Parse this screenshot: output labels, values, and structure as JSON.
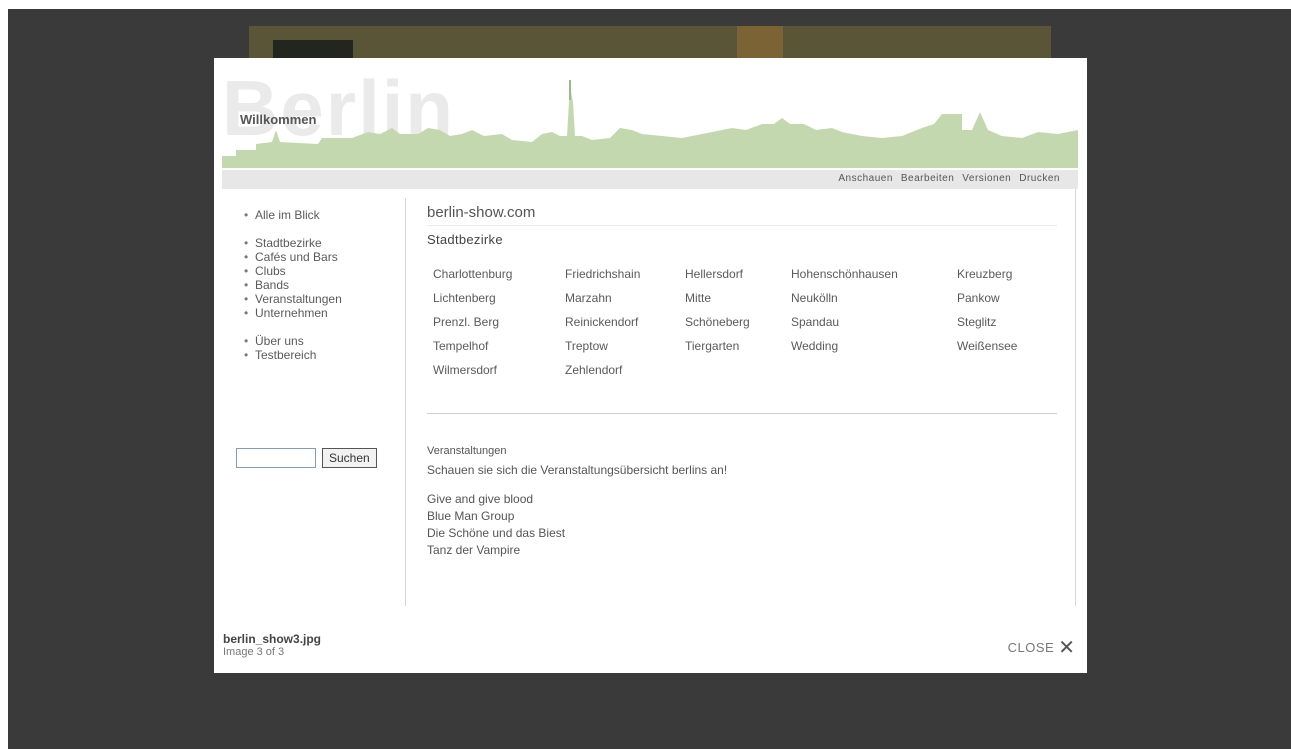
{
  "header": {
    "bg_word": "Berlin",
    "title": "Willkommen",
    "nav": [
      "Anschauen",
      "Bearbeiten",
      "Versionen",
      "Drucken"
    ]
  },
  "sidebar": {
    "group1": [
      "Alle im Blick"
    ],
    "group2": [
      "Stadtbezirke",
      "Cafés und Bars",
      "Clubs",
      "Bands",
      "Veranstaltungen",
      "Unternehmen"
    ],
    "group3": [
      "Über uns",
      "Testbereich"
    ]
  },
  "search": {
    "value": "",
    "button": "Suchen"
  },
  "content": {
    "site_name": "berlin-show.com",
    "section1": "Stadtbezirke",
    "districts": [
      "Charlottenburg",
      "Friedrichshain",
      "Hellersdorf",
      "Hohenschönhausen",
      "Kreuzberg",
      "Lichtenberg",
      "Marzahn",
      "Mitte",
      "Neukölln",
      "Pankow",
      "Prenzl. Berg",
      "Reinickendorf",
      "Schöneberg",
      "Spandau",
      "Steglitz",
      "Tempelhof",
      "Treptow",
      "Tiergarten",
      "Wedding",
      "Weißensee",
      "Wilmersdorf",
      "Zehlendorf"
    ],
    "section2": "Veranstaltungen",
    "intro": "Schauen sie sich die Veranstaltungsübersicht berlins an!",
    "events": [
      "Give and give blood",
      "Blue Man Group",
      "Die Schöne und das Biest",
      "Tanz der Vampire"
    ]
  },
  "caption": {
    "filename": "berlin_show3.jpg",
    "count": "Image 3 of 3"
  },
  "close_label": "CLOSE"
}
